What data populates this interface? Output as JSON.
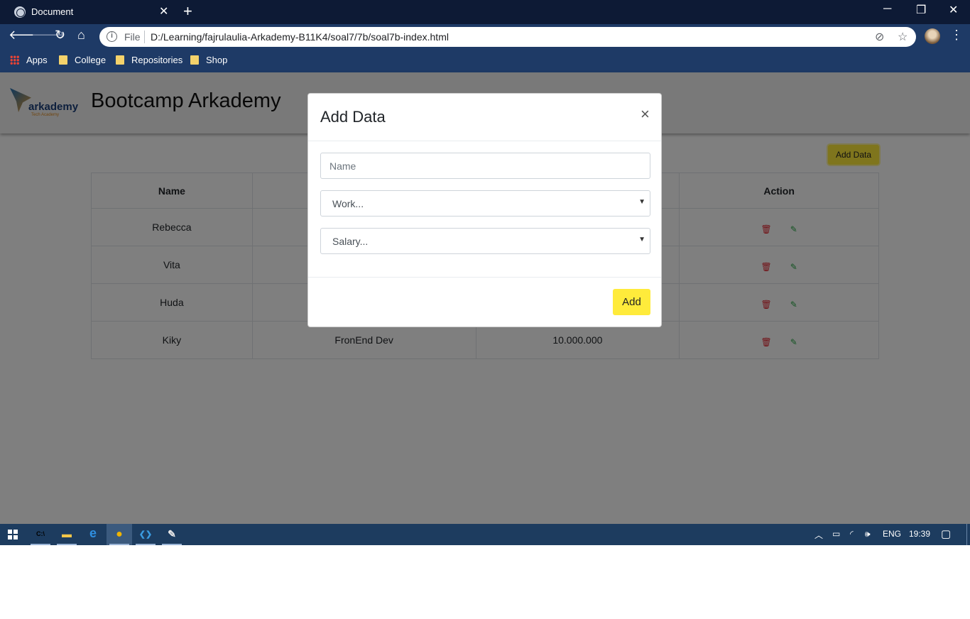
{
  "browser": {
    "tab_title": "Document",
    "tab_close": "✕",
    "new_tab": "+",
    "omnibox_scheme": "File",
    "url": "D:/Learning/fajrulaulia-Arkademy-B11K4/soal7/7b/soal7b-index.html",
    "bookmarks": [
      {
        "label": "Apps",
        "icon": "apps-grid-icon"
      },
      {
        "label": "College",
        "icon": "folder-icon"
      },
      {
        "label": "Repositories",
        "icon": "folder-icon"
      },
      {
        "label": "Shop",
        "icon": "folder-icon"
      }
    ]
  },
  "page": {
    "logo_text": "arkademy",
    "logo_subtext": "Tech Academy",
    "title": "Bootcamp Arkademy",
    "add_data_label": "Add Data",
    "table": {
      "headers": [
        "Name",
        "",
        "",
        "Action"
      ],
      "rows": [
        {
          "name": "Rebecca",
          "work": "",
          "salary": ""
        },
        {
          "name": "Vita",
          "work": "",
          "salary": ""
        },
        {
          "name": "Huda",
          "work": "",
          "salary": ""
        },
        {
          "name": "Kiky",
          "work": "FronEnd Dev",
          "salary": "10.000.000"
        }
      ]
    }
  },
  "modal": {
    "title": "Add Data",
    "close": "×",
    "name_placeholder": "Name",
    "work_selected": "Work...",
    "salary_selected": "Salary...",
    "submit_label": "Add"
  },
  "taskbar": {
    "language": "ENG",
    "time": "19:39",
    "apps": [
      {
        "name": "cmd",
        "glyph": "C:\\",
        "color": "#ffffff"
      },
      {
        "name": "file-explorer",
        "glyph": "▬",
        "color": "#f3c649"
      },
      {
        "name": "edge",
        "glyph": "e",
        "color": "#2f8fe0"
      },
      {
        "name": "chrome",
        "glyph": "●",
        "color": "#f0b400"
      },
      {
        "name": "vscode",
        "glyph": "❮❯",
        "color": "#3a9be0"
      },
      {
        "name": "paint",
        "glyph": "✎",
        "color": "#e8e8e8"
      }
    ]
  },
  "colors": {
    "accent_yellow": "#ffeb3b",
    "delete_red": "#e3222d",
    "edit_green": "#28a745",
    "browser_dark": "#0d1a35",
    "browser_toolbar": "#1e3a66",
    "taskbar": "#1d3c5f"
  }
}
